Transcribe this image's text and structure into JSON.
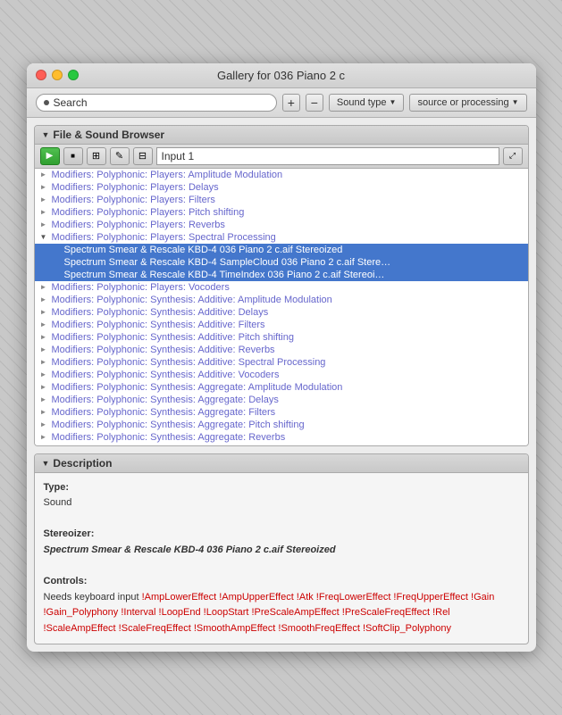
{
  "window": {
    "title": "Gallery for 036 Piano 2 c"
  },
  "toolbar": {
    "search_label": "Search",
    "add_btn": "+",
    "remove_btn": "−",
    "sound_type_label": "Sound type",
    "source_processing_label": "source or processing"
  },
  "file_browser": {
    "header": "File & Sound Browser",
    "path": "Input 1",
    "items": [
      {
        "id": 1,
        "indent": 1,
        "arrow": "►",
        "open": false,
        "text": "Modifiers: Polyphonic:  Players: Amplitude Modulation",
        "selected": false
      },
      {
        "id": 2,
        "indent": 1,
        "arrow": "►",
        "open": false,
        "text": "Modifiers: Polyphonic:  Players: Delays",
        "selected": false
      },
      {
        "id": 3,
        "indent": 1,
        "arrow": "►",
        "open": false,
        "text": "Modifiers: Polyphonic:  Players: Filters",
        "selected": false
      },
      {
        "id": 4,
        "indent": 1,
        "arrow": "►",
        "open": false,
        "text": "Modifiers: Polyphonic:  Players: Pitch shifting",
        "selected": false
      },
      {
        "id": 5,
        "indent": 1,
        "arrow": "►",
        "open": false,
        "text": "Modifiers: Polyphonic:  Players: Reverbs",
        "selected": false
      },
      {
        "id": 6,
        "indent": 1,
        "arrow": "▼",
        "open": true,
        "text": "Modifiers: Polyphonic:  Players: Spectral Processing",
        "selected": false
      },
      {
        "id": 7,
        "indent": 2,
        "arrow": "",
        "open": false,
        "text": "Spectrum Smear & Rescale KBD-4 036 Piano 2 c.aif Stereoized",
        "selected": true
      },
      {
        "id": 8,
        "indent": 2,
        "arrow": "",
        "open": false,
        "text": "Spectrum Smear & Rescale KBD-4 SampleCloud 036 Piano 2 c.aif Stere…",
        "selected": true
      },
      {
        "id": 9,
        "indent": 2,
        "arrow": "",
        "open": false,
        "text": "Spectrum Smear & Rescale KBD-4 TimeIndex 036 Piano 2 c.aif Stereoi…",
        "selected": true
      },
      {
        "id": 10,
        "indent": 1,
        "arrow": "►",
        "open": false,
        "text": "Modifiers: Polyphonic:  Players: Vocoders",
        "selected": false
      },
      {
        "id": 11,
        "indent": 1,
        "arrow": "►",
        "open": false,
        "text": "Modifiers: Polyphonic:  Synthesis: Additive: Amplitude Modulation",
        "selected": false
      },
      {
        "id": 12,
        "indent": 1,
        "arrow": "►",
        "open": false,
        "text": "Modifiers: Polyphonic:  Synthesis: Additive: Delays",
        "selected": false
      },
      {
        "id": 13,
        "indent": 1,
        "arrow": "►",
        "open": false,
        "text": "Modifiers: Polyphonic:  Synthesis: Additive: Filters",
        "selected": false
      },
      {
        "id": 14,
        "indent": 1,
        "arrow": "►",
        "open": false,
        "text": "Modifiers: Polyphonic:  Synthesis: Additive: Pitch shifting",
        "selected": false
      },
      {
        "id": 15,
        "indent": 1,
        "arrow": "►",
        "open": false,
        "text": "Modifiers: Polyphonic:  Synthesis: Additive: Reverbs",
        "selected": false
      },
      {
        "id": 16,
        "indent": 1,
        "arrow": "►",
        "open": false,
        "text": "Modifiers: Polyphonic:  Synthesis: Additive: Spectral Processing",
        "selected": false
      },
      {
        "id": 17,
        "indent": 1,
        "arrow": "►",
        "open": false,
        "text": "Modifiers: Polyphonic:  Synthesis: Additive: Vocoders",
        "selected": false
      },
      {
        "id": 18,
        "indent": 1,
        "arrow": "►",
        "open": false,
        "text": "Modifiers: Polyphonic:  Synthesis: Aggregate: Amplitude Modulation",
        "selected": false
      },
      {
        "id": 19,
        "indent": 1,
        "arrow": "►",
        "open": false,
        "text": "Modifiers: Polyphonic:  Synthesis: Aggregate: Delays",
        "selected": false
      },
      {
        "id": 20,
        "indent": 1,
        "arrow": "►",
        "open": false,
        "text": "Modifiers: Polyphonic:  Synthesis: Aggregate: Filters",
        "selected": false
      },
      {
        "id": 21,
        "indent": 1,
        "arrow": "►",
        "open": false,
        "text": "Modifiers: Polyphonic:  Synthesis: Aggregate: Pitch shifting",
        "selected": false
      },
      {
        "id": 22,
        "indent": 1,
        "arrow": "►",
        "open": false,
        "text": "Modifiers: Polyphonic:  Synthesis: Aggregate: Reverbs",
        "selected": false
      }
    ]
  },
  "description": {
    "header": "Description",
    "type_label": "Type:",
    "type_value": "Sound",
    "stereoizer_label": "Stereoizer:",
    "stereoizer_value": "Spectrum Smear & Rescale KBD-4 036 Piano 2 c.aif Stereoized",
    "controls_label": "Controls:",
    "controls_prefix": "Needs keyboard input ",
    "controls_text": "!AmpLowerEffect !AmpUpperEffect !Atk !FreqLowerEffect !FreqUpperEffect !Gain !Gain_Polyphony !Interval !LoopEnd  !LoopStart !PreScaleAmpEffect !PreScaleFreqEffect !Rel !ScaleAmpEffect !ScaleFreqEffect !SmoothAmpEffect !SmoothFreqEffect !SoftClip_Polyphony"
  }
}
